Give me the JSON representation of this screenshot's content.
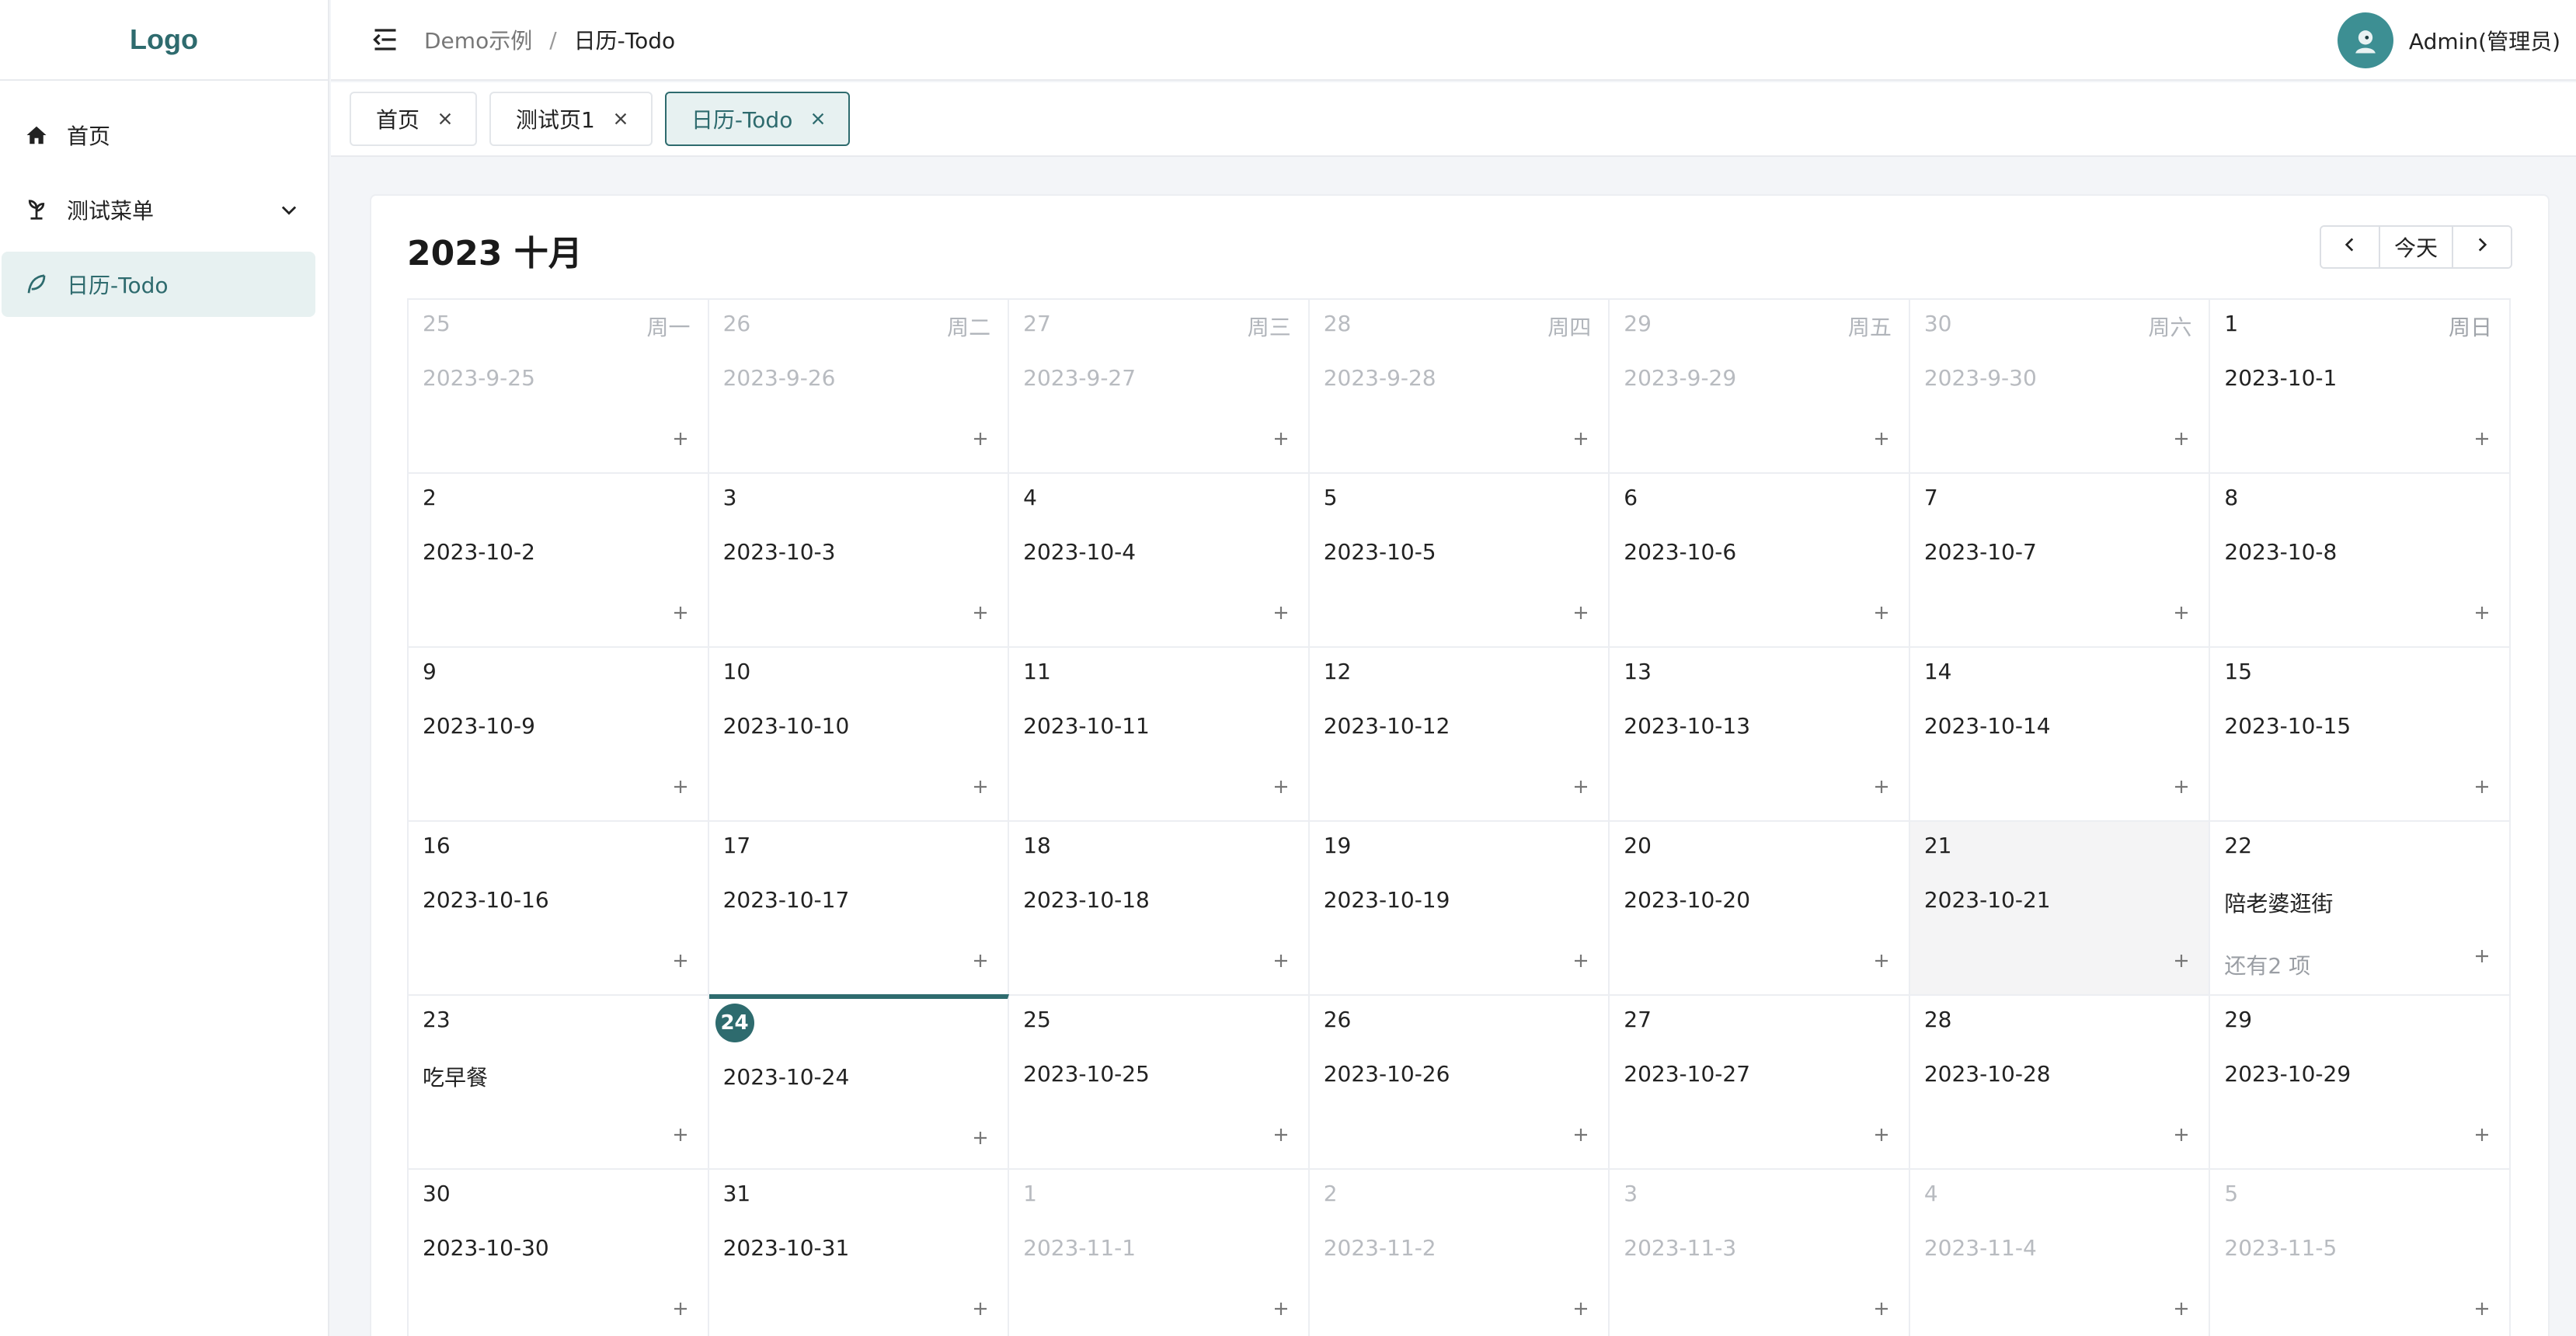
{
  "sidebar": {
    "logo": "Logo",
    "items": [
      {
        "label": "首页",
        "icon": "home-icon"
      },
      {
        "label": "测试菜单",
        "icon": "plant-icon"
      },
      {
        "label": "日历-Todo",
        "icon": "feather-icon"
      }
    ]
  },
  "header": {
    "breadcrumb": [
      "Demo示例",
      "日历-Todo"
    ],
    "separator": "/",
    "user": "Admin(管理员)"
  },
  "tabs": [
    {
      "label": "首页"
    },
    {
      "label": "测试页1"
    },
    {
      "label": "日历-Todo"
    }
  ],
  "calendar": {
    "title": "2023 十月",
    "today_label": "今天",
    "weekdays": [
      "周一",
      "周二",
      "周三",
      "周四",
      "周五",
      "周六",
      "周日"
    ],
    "accent_color": "#2e6b6e",
    "weeks": [
      [
        {
          "day": "25",
          "text": "2023-9-25",
          "muted": true
        },
        {
          "day": "26",
          "text": "2023-9-26",
          "muted": true
        },
        {
          "day": "27",
          "text": "2023-9-27",
          "muted": true
        },
        {
          "day": "28",
          "text": "2023-9-28",
          "muted": true
        },
        {
          "day": "29",
          "text": "2023-9-29",
          "muted": true
        },
        {
          "day": "30",
          "text": "2023-9-30",
          "muted": true
        },
        {
          "day": "1",
          "text": "2023-10-1"
        }
      ],
      [
        {
          "day": "2",
          "text": "2023-10-2"
        },
        {
          "day": "3",
          "text": "2023-10-3"
        },
        {
          "day": "4",
          "text": "2023-10-4"
        },
        {
          "day": "5",
          "text": "2023-10-5"
        },
        {
          "day": "6",
          "text": "2023-10-6"
        },
        {
          "day": "7",
          "text": "2023-10-7"
        },
        {
          "day": "8",
          "text": "2023-10-8"
        }
      ],
      [
        {
          "day": "9",
          "text": "2023-10-9"
        },
        {
          "day": "10",
          "text": "2023-10-10"
        },
        {
          "day": "11",
          "text": "2023-10-11"
        },
        {
          "day": "12",
          "text": "2023-10-12"
        },
        {
          "day": "13",
          "text": "2023-10-13"
        },
        {
          "day": "14",
          "text": "2023-10-14"
        },
        {
          "day": "15",
          "text": "2023-10-15"
        }
      ],
      [
        {
          "day": "16",
          "text": "2023-10-16"
        },
        {
          "day": "17",
          "text": "2023-10-17"
        },
        {
          "day": "18",
          "text": "2023-10-18"
        },
        {
          "day": "19",
          "text": "2023-10-19"
        },
        {
          "day": "20",
          "text": "2023-10-20"
        },
        {
          "day": "21",
          "text": "2023-10-21",
          "highlight": true
        },
        {
          "day": "22",
          "text": "陪老婆逛街",
          "more": "还有2 项"
        }
      ],
      [
        {
          "day": "23",
          "text": "吃早餐"
        },
        {
          "day": "24",
          "text": "2023-10-24",
          "today": true
        },
        {
          "day": "25",
          "text": "2023-10-25"
        },
        {
          "day": "26",
          "text": "2023-10-26"
        },
        {
          "day": "27",
          "text": "2023-10-27"
        },
        {
          "day": "28",
          "text": "2023-10-28"
        },
        {
          "day": "29",
          "text": "2023-10-29"
        }
      ],
      [
        {
          "day": "30",
          "text": "2023-10-30"
        },
        {
          "day": "31",
          "text": "2023-10-31"
        },
        {
          "day": "1",
          "text": "2023-11-1",
          "muted": true
        },
        {
          "day": "2",
          "text": "2023-11-2",
          "muted": true
        },
        {
          "day": "3",
          "text": "2023-11-3",
          "muted": true
        },
        {
          "day": "4",
          "text": "2023-11-4",
          "muted": true
        },
        {
          "day": "5",
          "text": "2023-11-5",
          "muted": true
        }
      ]
    ]
  }
}
